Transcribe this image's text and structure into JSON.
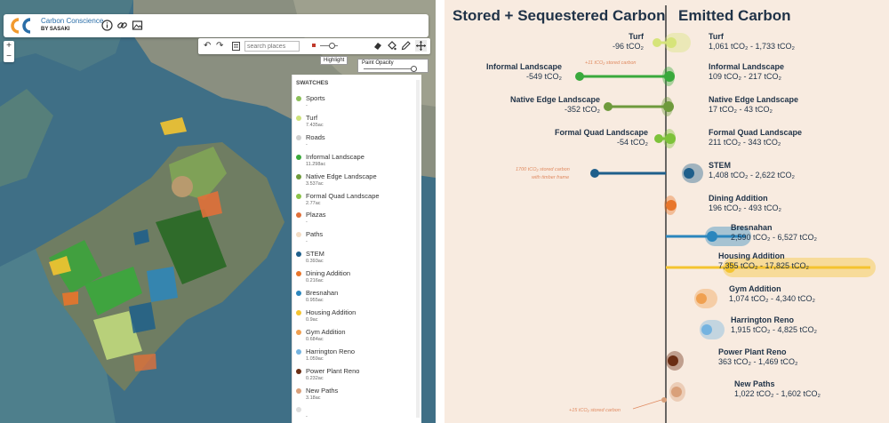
{
  "app": {
    "name": "Carbon Conscience",
    "by": "BY SASAKI"
  },
  "toolbar": {
    "undo": "↶",
    "redo": "↷",
    "search_placeholder": "search places",
    "highlight_tip": "Highlight",
    "opacity_label": "Paint Opacity"
  },
  "zoom": {
    "in": "+",
    "out": "−"
  },
  "swatches": {
    "title": "SWATCHES",
    "items": [
      {
        "name": "Sports",
        "area": "-",
        "color": "#8cbf5a"
      },
      {
        "name": "Turf",
        "area": "7.435ac",
        "color": "#cde27a"
      },
      {
        "name": "Roads",
        "area": "-",
        "color": "#cfcfcf"
      },
      {
        "name": "Informal Landscape",
        "area": "11.298ac",
        "color": "#3aa93c"
      },
      {
        "name": "Native Edge Landscape",
        "area": "3.537ac",
        "color": "#6e9a3c"
      },
      {
        "name": "Formal Quad Landscape",
        "area": "2.77ac",
        "color": "#8bc34a"
      },
      {
        "name": "Plazas",
        "area": "-",
        "color": "#e0703a"
      },
      {
        "name": "Paths",
        "area": "-",
        "color": "#f2dcc4"
      },
      {
        "name": "STEM",
        "area": "0.393ac",
        "color": "#1f5f8b"
      },
      {
        "name": "Dining Addition",
        "area": "0.216ac",
        "color": "#e8762b"
      },
      {
        "name": "Bresnahan",
        "area": "0.955ac",
        "color": "#2b86bd"
      },
      {
        "name": "Housing Addition",
        "area": "0.9ac",
        "color": "#f4c430"
      },
      {
        "name": "Gym Addition",
        "area": "0.684ac",
        "color": "#f0a050"
      },
      {
        "name": "Harrington Reno",
        "area": "1.059ac",
        "color": "#74b3e0"
      },
      {
        "name": "Power Plant Reno",
        "area": "0.232ac",
        "color": "#6b2e14"
      },
      {
        "name": "New Paths",
        "area": "3.18ac",
        "color": "#d9a07a"
      },
      {
        "name": "",
        "area": "-",
        "color": "#dddddd"
      }
    ]
  },
  "chart": {
    "left_title": "Stored + Sequestered Carbon",
    "right_title": "Emitted Carbon",
    "rows": [
      {
        "name": "Turf",
        "stored": "-96 tCO₂",
        "emitted": "1,061 tCO₂ - 1,733 tCO₂",
        "note": "+11 tCO₂ stored carbon",
        "color": "#d6e47a"
      },
      {
        "name": "Informal Landscape",
        "stored": "-549 tCO₂",
        "emitted": "109 tCO₂ - 217 tCO₂",
        "note": "",
        "color": "#3aa93c"
      },
      {
        "name": "Native Edge Landscape",
        "stored": "-352 tCO₂",
        "emitted": "17 tCO₂ - 43 tCO₂",
        "note": "",
        "color": "#6e9a3c"
      },
      {
        "name": "Formal Quad Landscape",
        "stored": "-54 tCO₂",
        "emitted": "211 tCO₂ - 343 tCO₂",
        "note": "",
        "color": "#7dc23a"
      },
      {
        "name": "STEM",
        "stored": "",
        "emitted": "1,408 tCO₂ - 2,622 tCO₂",
        "note": "1700 tCO₂ stored carbon",
        "note2": "with timber frame",
        "color": "#1f5f8b"
      },
      {
        "name": "Dining Addition",
        "stored": "",
        "emitted": "196 tCO₂ - 493 tCO₂",
        "note": "",
        "color": "#e8762b"
      },
      {
        "name": "Bresnahan",
        "stored": "",
        "emitted": "2,590 tCO₂ - 6,527 tCO₂",
        "note": "",
        "color": "#2b86bd"
      },
      {
        "name": "Housing Addition",
        "stored": "",
        "emitted": "7,355 tCO₂ - 17,825 tCO₂",
        "note": "",
        "color": "#f4c430"
      },
      {
        "name": "Gym Addition",
        "stored": "",
        "emitted": "1,074 tCO₂ - 4,340 tCO₂",
        "note": "",
        "color": "#f0a050"
      },
      {
        "name": "Harrington Reno",
        "stored": "",
        "emitted": "1,915 tCO₂ - 4,825 tCO₂",
        "note": "",
        "color": "#74b3e0"
      },
      {
        "name": "Power Plant Reno",
        "stored": "",
        "emitted": "363 tCO₂ - 1,469 tCO₂",
        "note": "",
        "color": "#6b2e14"
      },
      {
        "name": "New Paths",
        "stored": "",
        "emitted": "1,022 tCO₂ - 1,602 tCO₂",
        "note": "+15 tCO₂ stored carbon",
        "color": "#d9a07a"
      }
    ]
  }
}
